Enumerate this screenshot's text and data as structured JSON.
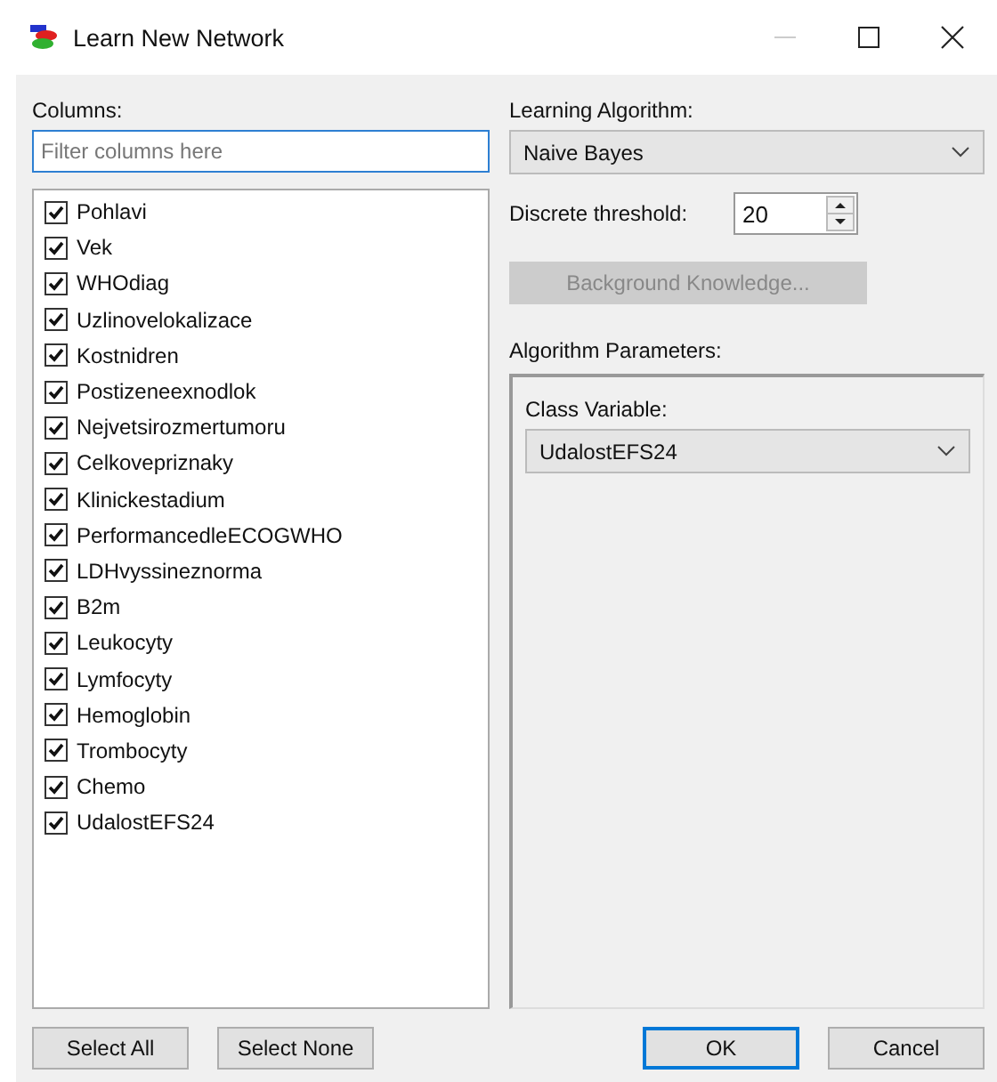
{
  "window": {
    "title": "Learn New Network"
  },
  "columns": {
    "label": "Columns:",
    "filter": {
      "placeholder": "Filter columns here"
    },
    "items": [
      {
        "label": "Pohlavi",
        "checked": true
      },
      {
        "label": "Vek",
        "checked": true
      },
      {
        "label": "WHOdiag",
        "checked": true
      },
      {
        "label": "Uzlinovelokalizace",
        "checked": true
      },
      {
        "label": "Kostnidren",
        "checked": true
      },
      {
        "label": "Postizeneexnodlok",
        "checked": true
      },
      {
        "label": "Nejvetsirozmertumoru",
        "checked": true
      },
      {
        "label": "Celkovepriznaky",
        "checked": true
      },
      {
        "label": "Klinickestadium",
        "checked": true
      },
      {
        "label": "PerformancedleECOGWHO",
        "checked": true
      },
      {
        "label": "LDHvyssineznorma",
        "checked": true
      },
      {
        "label": "B2m",
        "checked": true
      },
      {
        "label": "Leukocyty",
        "checked": true
      },
      {
        "label": "Lymfocyty",
        "checked": true
      },
      {
        "label": "Hemoglobin",
        "checked": true
      },
      {
        "label": "Trombocyty",
        "checked": true
      },
      {
        "label": "Chemo",
        "checked": true
      },
      {
        "label": "UdalostEFS24",
        "checked": true
      }
    ]
  },
  "learning_algorithm": {
    "label": "Learning Algorithm:",
    "value": "Naive Bayes"
  },
  "discrete_threshold": {
    "label": "Discrete threshold:",
    "value": "20"
  },
  "background_knowledge": {
    "label": "Background Knowledge...",
    "disabled": true
  },
  "algorithm_parameters": {
    "label": "Algorithm Parameters:",
    "class_variable": {
      "label": "Class Variable:",
      "value": "UdalostEFS24"
    }
  },
  "buttons": [
    {
      "label": "Select All",
      "kind": "left",
      "default": false
    },
    {
      "label": "Select None",
      "kind": "left",
      "default": false
    },
    {
      "label": "OK",
      "kind": "right",
      "default": true
    },
    {
      "label": "Cancel",
      "kind": "right",
      "default": false
    }
  ]
}
